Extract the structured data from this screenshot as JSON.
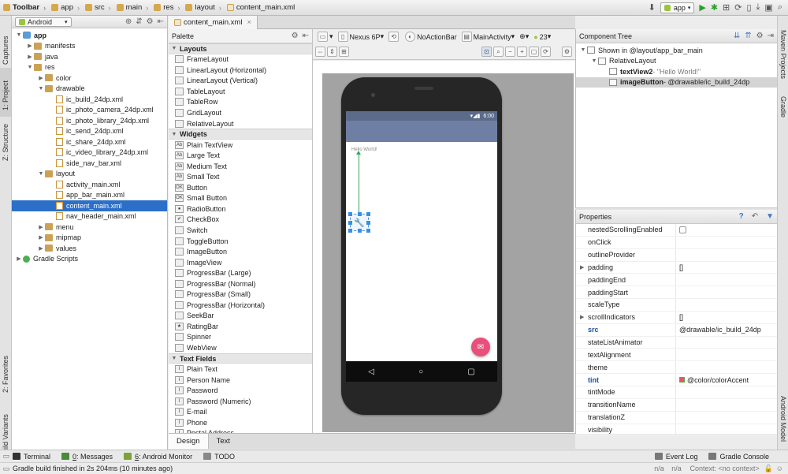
{
  "breadcrumb": [
    {
      "label": "Toolbar",
      "bold": true,
      "icon": "folder"
    },
    {
      "label": "app",
      "icon": "folder"
    },
    {
      "label": "src",
      "icon": "folder"
    },
    {
      "label": "main",
      "icon": "folder"
    },
    {
      "label": "res",
      "icon": "folder"
    },
    {
      "label": "layout",
      "icon": "folder"
    },
    {
      "label": "content_main.xml",
      "icon": "xml"
    }
  ],
  "run": {
    "config": "app"
  },
  "left_strip": {
    "captures": "Captures",
    "project": "1: Project",
    "structure": "Z: Structure",
    "favorites": "2: Favorites",
    "build_variants": "Build Variants"
  },
  "right_strip": {
    "maven": "Maven Projects",
    "gradle": "Gradle",
    "android_model": "Android Model"
  },
  "project": {
    "view": "Android",
    "tree": [
      {
        "label": "app",
        "depth": 0,
        "arrow": "down",
        "icon": "mod",
        "bold": true
      },
      {
        "label": "manifests",
        "depth": 1,
        "arrow": "right",
        "icon": "folder"
      },
      {
        "label": "java",
        "depth": 1,
        "arrow": "right",
        "icon": "folder"
      },
      {
        "label": "res",
        "depth": 1,
        "arrow": "down",
        "icon": "folder"
      },
      {
        "label": "color",
        "depth": 2,
        "arrow": "right",
        "icon": "folder"
      },
      {
        "label": "drawable",
        "depth": 2,
        "arrow": "down",
        "icon": "folder"
      },
      {
        "label": "ic_build_24dp.xml",
        "depth": 3,
        "arrow": "",
        "icon": "xml"
      },
      {
        "label": "ic_photo_camera_24dp.xml",
        "depth": 3,
        "arrow": "",
        "icon": "xml"
      },
      {
        "label": "ic_photo_library_24dp.xml",
        "depth": 3,
        "arrow": "",
        "icon": "xml"
      },
      {
        "label": "ic_send_24dp.xml",
        "depth": 3,
        "arrow": "",
        "icon": "xml"
      },
      {
        "label": "ic_share_24dp.xml",
        "depth": 3,
        "arrow": "",
        "icon": "xml"
      },
      {
        "label": "ic_video_library_24dp.xml",
        "depth": 3,
        "arrow": "",
        "icon": "xml"
      },
      {
        "label": "side_nav_bar.xml",
        "depth": 3,
        "arrow": "",
        "icon": "xml"
      },
      {
        "label": "layout",
        "depth": 2,
        "arrow": "down",
        "icon": "folder"
      },
      {
        "label": "activity_main.xml",
        "depth": 3,
        "arrow": "",
        "icon": "xml"
      },
      {
        "label": "app_bar_main.xml",
        "depth": 3,
        "arrow": "",
        "icon": "xml"
      },
      {
        "label": "content_main.xml",
        "depth": 3,
        "arrow": "",
        "icon": "xml",
        "selected": true
      },
      {
        "label": "nav_header_main.xml",
        "depth": 3,
        "arrow": "",
        "icon": "xml"
      },
      {
        "label": "menu",
        "depth": 2,
        "arrow": "right",
        "icon": "folder"
      },
      {
        "label": "mipmap",
        "depth": 2,
        "arrow": "right",
        "icon": "folder"
      },
      {
        "label": "values",
        "depth": 2,
        "arrow": "right",
        "icon": "folder"
      },
      {
        "label": "Gradle Scripts",
        "depth": 0,
        "arrow": "right",
        "icon": "gradle"
      }
    ]
  },
  "editor_tab": "content_main.xml",
  "palette": {
    "title": "Palette",
    "groups": [
      {
        "name": "Layouts",
        "items": [
          {
            "label": "FrameLayout",
            "icon": ""
          },
          {
            "label": "LinearLayout (Horizontal)",
            "icon": ""
          },
          {
            "label": "LinearLayout (Vertical)",
            "icon": ""
          },
          {
            "label": "TableLayout",
            "icon": ""
          },
          {
            "label": "TableRow",
            "icon": ""
          },
          {
            "label": "GridLayout",
            "icon": ""
          },
          {
            "label": "RelativeLayout",
            "icon": ""
          }
        ]
      },
      {
        "name": "Widgets",
        "items": [
          {
            "label": "Plain TextView",
            "icon": "Ab"
          },
          {
            "label": "Large Text",
            "icon": "Ab"
          },
          {
            "label": "Medium Text",
            "icon": "Ab"
          },
          {
            "label": "Small Text",
            "icon": "Ab"
          },
          {
            "label": "Button",
            "icon": "OK"
          },
          {
            "label": "Small Button",
            "icon": "OK"
          },
          {
            "label": "RadioButton",
            "icon": "●"
          },
          {
            "label": "CheckBox",
            "icon": "✔"
          },
          {
            "label": "Switch",
            "icon": ""
          },
          {
            "label": "ToggleButton",
            "icon": ""
          },
          {
            "label": "ImageButton",
            "icon": ""
          },
          {
            "label": "ImageView",
            "icon": ""
          },
          {
            "label": "ProgressBar (Large)",
            "icon": ""
          },
          {
            "label": "ProgressBar (Normal)",
            "icon": ""
          },
          {
            "label": "ProgressBar (Small)",
            "icon": ""
          },
          {
            "label": "ProgressBar (Horizontal)",
            "icon": ""
          },
          {
            "label": "SeekBar",
            "icon": ""
          },
          {
            "label": "RatingBar",
            "icon": "★"
          },
          {
            "label": "Spinner",
            "icon": ""
          },
          {
            "label": "WebView",
            "icon": ""
          }
        ]
      },
      {
        "name": "Text Fields",
        "items": [
          {
            "label": "Plain Text",
            "icon": "I"
          },
          {
            "label": "Person Name",
            "icon": "I"
          },
          {
            "label": "Password",
            "icon": "I"
          },
          {
            "label": "Password (Numeric)",
            "icon": "I"
          },
          {
            "label": "E-mail",
            "icon": "I"
          },
          {
            "label": "Phone",
            "icon": "I"
          },
          {
            "label": "Postal Address",
            "icon": "I"
          }
        ]
      }
    ]
  },
  "design_toolbar": {
    "device": "Nexus 6P",
    "theme": "NoActionBar",
    "activity": "MainActivity",
    "api": "23"
  },
  "preview": {
    "status_time": "6:00",
    "hello_text": "Hello World!"
  },
  "editor_modes": {
    "design": "Design",
    "text": "Text"
  },
  "component_tree": {
    "title": "Component Tree",
    "rows": [
      {
        "label": "Shown in @layout/app_bar_main",
        "detail": "",
        "depth": 0,
        "bold": false
      },
      {
        "label": "RelativeLayout",
        "detail": "",
        "depth": 1,
        "bold": false
      },
      {
        "label": "textView2",
        "detail": " - \"Hello World!\"",
        "depth": 2,
        "bold": true
      },
      {
        "label": "imageButton",
        "detail": " - @drawable/ic_build_24dp",
        "depth": 2,
        "bold": true,
        "selected": true
      }
    ]
  },
  "properties": {
    "title": "Properties",
    "rows": [
      {
        "name": "nestedScrollingEnabled",
        "value": "",
        "type": "checkbox"
      },
      {
        "name": "onClick",
        "value": ""
      },
      {
        "name": "outlineProvider",
        "value": ""
      },
      {
        "name": "padding",
        "value": "[]",
        "expand": true
      },
      {
        "name": "paddingEnd",
        "value": ""
      },
      {
        "name": "paddingStart",
        "value": ""
      },
      {
        "name": "scaleType",
        "value": ""
      },
      {
        "name": "scrollIndicators",
        "value": "[]",
        "expand": true
      },
      {
        "name": "src",
        "value": "@drawable/ic_build_24dp",
        "modified": true
      },
      {
        "name": "stateListAnimator",
        "value": ""
      },
      {
        "name": "textAlignment",
        "value": ""
      },
      {
        "name": "theme",
        "value": ""
      },
      {
        "name": "tint",
        "value": "@color/colorAccent",
        "modified": true,
        "swatch": "#e8507c"
      },
      {
        "name": "tintMode",
        "value": ""
      },
      {
        "name": "transitionName",
        "value": ""
      },
      {
        "name": "translationZ",
        "value": ""
      },
      {
        "name": "visibility",
        "value": ""
      }
    ]
  },
  "bottom_tools": [
    {
      "label": "Terminal",
      "key": ""
    },
    {
      "label": ": Messages",
      "key": "0"
    },
    {
      "label": ": Android Monitor",
      "key": "6"
    },
    {
      "label": "TODO",
      "key": ""
    }
  ],
  "bottom_right_tools": [
    {
      "label": "Event Log"
    },
    {
      "label": "Gradle Console"
    }
  ],
  "status": {
    "message": "Gradle build finished in 2s 204ms (10 minutes ago)",
    "na1": "n/a",
    "na2": "n/a",
    "context": "Context: <no context>"
  },
  "colors": {
    "accent": "#e8507c",
    "primary": "#6f7ea3",
    "primary_dark": "#5c6b8a",
    "selection": "#2c6fc9"
  }
}
